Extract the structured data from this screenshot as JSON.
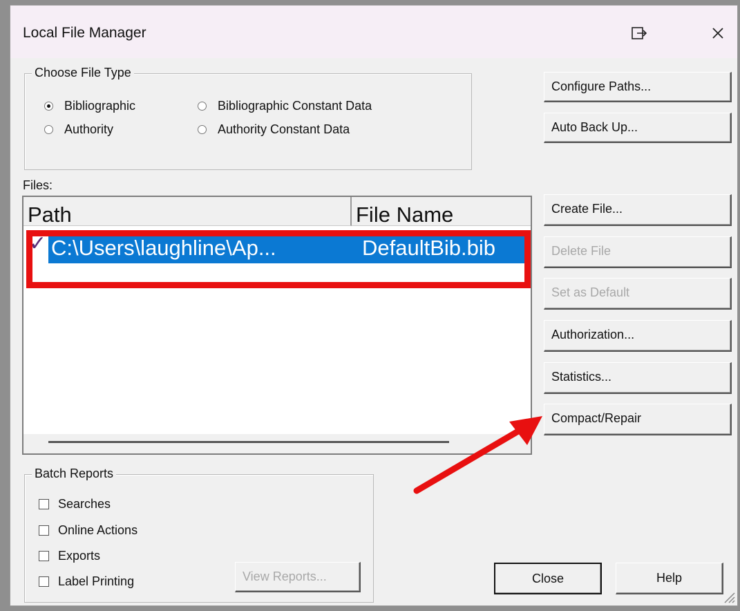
{
  "window": {
    "title": "Local File Manager"
  },
  "file_type": {
    "legend": "Choose File Type",
    "options": [
      {
        "label": "Bibliographic",
        "selected": true
      },
      {
        "label": "Bibliographic Constant Data",
        "selected": false
      },
      {
        "label": "Authority",
        "selected": false
      },
      {
        "label": "Authority Constant Data",
        "selected": false
      }
    ]
  },
  "side_buttons": {
    "configure_paths": "Configure Paths...",
    "auto_back_up": "Auto Back Up...",
    "create_file": "Create File...",
    "delete_file": "Delete File",
    "set_as_default": "Set as Default",
    "authorization": "Authorization...",
    "statistics": "Statistics...",
    "compact_repair": "Compact/Repair"
  },
  "files": {
    "label": "Files:",
    "columns": [
      "Path",
      "File Name"
    ],
    "rows": [
      {
        "path": "C:\\Users\\laughline\\Ap...",
        "file_name": "DefaultBib.bib",
        "checked": true,
        "selected": true
      }
    ]
  },
  "batch_reports": {
    "legend": "Batch Reports",
    "items": [
      {
        "label": "Searches",
        "checked": false
      },
      {
        "label": "Online Actions",
        "checked": false
      },
      {
        "label": "Exports",
        "checked": false
      },
      {
        "label": "Label Printing",
        "checked": false
      }
    ],
    "view_reports": "View Reports..."
  },
  "footer": {
    "close": "Close",
    "help": "Help"
  },
  "annotation": {
    "highlight_color": "#e81010",
    "selection_color": "#0b79d3"
  }
}
